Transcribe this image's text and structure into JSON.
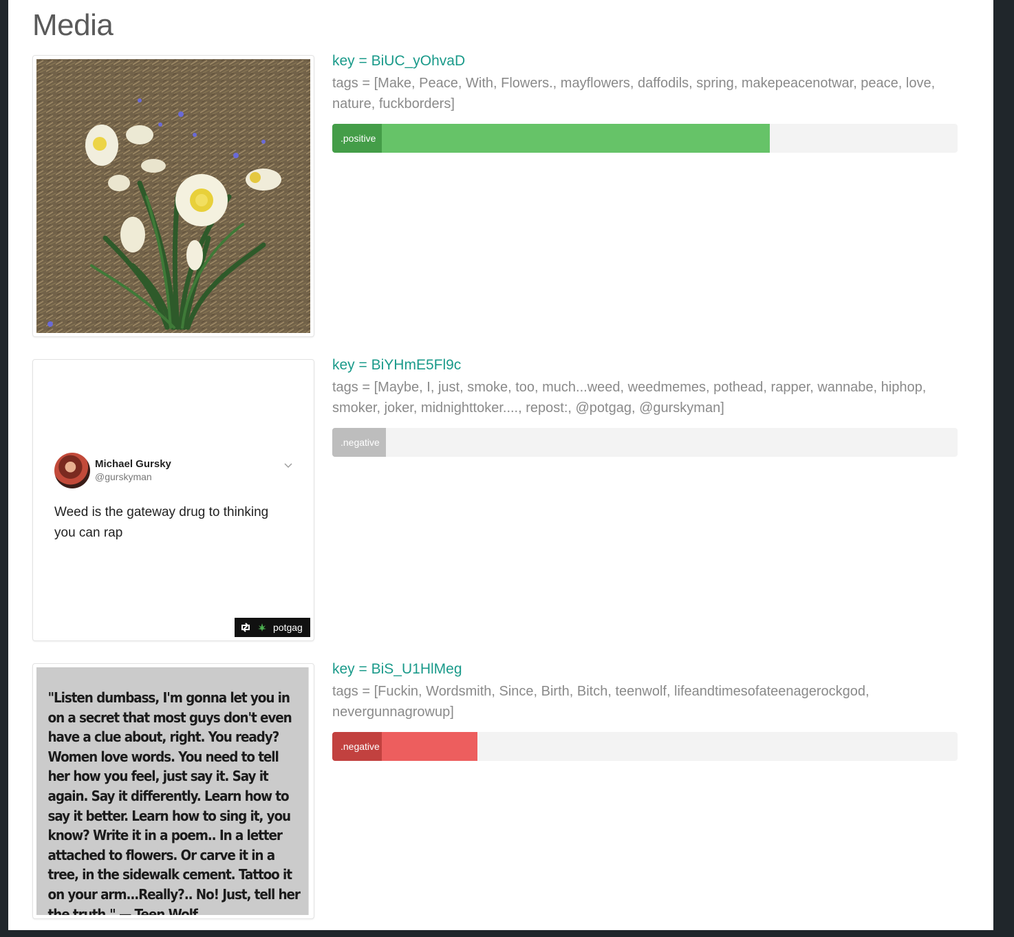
{
  "page": {
    "title": "Media"
  },
  "items": [
    {
      "key": "key = BiUC_yOhvaD",
      "tags": "tags = [Make, Peace, With, Flowers., mayflowers, daffodils, spring, makepeacenotwar, peace, love, nature, fuckborders]",
      "sentiment": {
        "label": ".positive",
        "fraction": 0.7,
        "color": "#66c368",
        "label_color": "#449d48"
      },
      "image": {
        "kind": "photo",
        "alt": "daffodils"
      }
    },
    {
      "key": "key = BiYHmE5Fl9c",
      "tags": "tags = [Maybe, I, just, smoke, too, much...weed, weedmemes, pothead, rapper, wannabe, hiphop, smoker, joker, midnighttoker...., repost:, @potgag, @gurskyman]",
      "sentiment": {
        "label": ".negative",
        "fraction": 0.086,
        "color": "#bdbdbd",
        "label_color": "#bdbdbd"
      },
      "image": {
        "kind": "tweet",
        "name": "Michael Gursky",
        "handle": "@gurskyman",
        "text": "Weed is the gateway drug to thinking you can rap",
        "regram": "potgag",
        "regram_icon": "repost-icon",
        "chevron_icon": "chevron-down-icon"
      }
    },
    {
      "key": "key = BiS_U1HlMeg",
      "tags": "tags = [Fuckin, Wordsmith, Since, Birth, Bitch, teenwolf, lifeandtimesofateenagerockgod, nevergunnagrowup]",
      "sentiment": {
        "label": ".negative",
        "fraction": 0.232,
        "color": "#ed5e5e",
        "label_color": "#c2413f"
      },
      "image": {
        "kind": "quote",
        "text": "\"Listen dumbass, I'm gonna let you in on a secret that most guys don't even have a clue about, right. You ready? Women love words. You need to tell her how you feel, just say it. Say it again. Say it differently. Learn how to say it better. Learn how to sing it, you know? Write it in a poem..  In a letter attached to flowers.  Or carve it in a tree, in the sidewalk cement. Tattoo it on your arm...Really?..  No! Just, tell her the truth.\" — Teen Wolf"
      }
    }
  ]
}
